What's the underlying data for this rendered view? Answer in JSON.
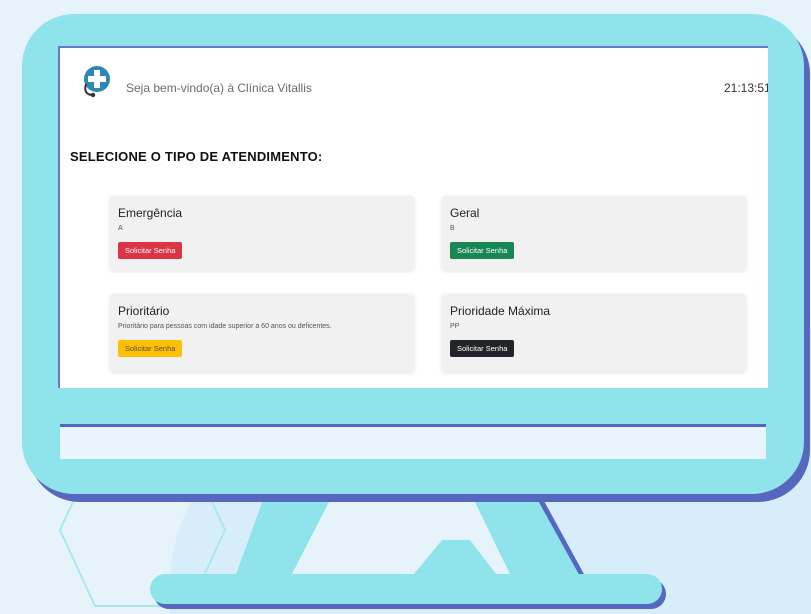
{
  "app": {
    "welcome_text": "Seja bem-vindo(a) à Clínica Vitallis",
    "clock": "21:13:51"
  },
  "section_title": "SELECIONE O TIPO DE ATENDIMENTO:",
  "cards": [
    {
      "title": "Emergência",
      "code": "A",
      "button": "Solicitar Senha",
      "button_color": "#dc3545"
    },
    {
      "title": "Geral",
      "code": "B",
      "button": "Solicitar Senha",
      "button_color": "#198754"
    },
    {
      "title": "Prioritário",
      "code": "Prioritário para pessoas com idade superior a 60 anos ou deficentes.",
      "button": "Solicitar Senha",
      "button_color": "#ffc107"
    },
    {
      "title": "Prioridade Máxima",
      "code": "PP",
      "button": "Solicitar Senha",
      "button_color": "#212529"
    }
  ],
  "colors": {
    "monitor": "#8fe3ea",
    "monitor_shadow": "#5667bf",
    "background": "#e6f3fb"
  },
  "icons": {
    "logo": "medical-cross-stethoscope-icon"
  }
}
